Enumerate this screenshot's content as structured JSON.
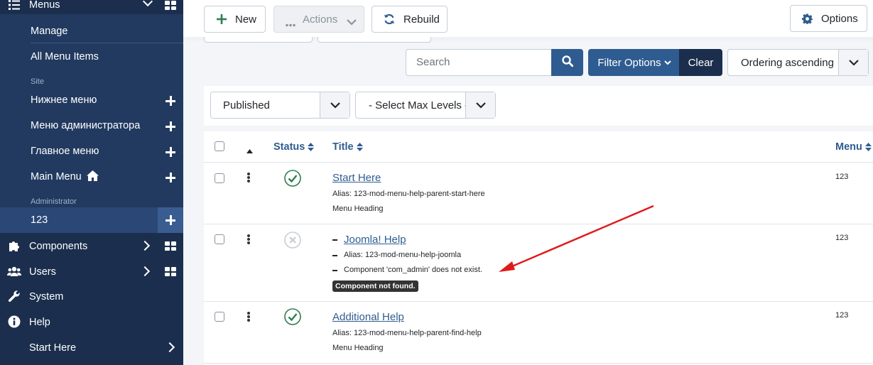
{
  "sidebar": {
    "menus_label": "Menus",
    "manage": "Manage",
    "all_menu_items": "All Menu Items",
    "site_section": "Site",
    "site_menus": [
      "Нижнее меню",
      "Меню администратора",
      "Главное меню",
      "Main Menu"
    ],
    "admin_section": "Administrator",
    "admin_menu": "123",
    "components": "Components",
    "users": "Users",
    "system": "System",
    "help": "Help",
    "start_here": "Start Here"
  },
  "toolbar": {
    "new_label": "New",
    "actions_label": "Actions",
    "rebuild_label": "Rebuild",
    "options_label": "Options"
  },
  "search": {
    "placeholder": "Search",
    "filter_options_label": "Filter Options",
    "clear_label": "Clear",
    "ordering_value": "Ordering ascending"
  },
  "filters": {
    "published_value": "Published",
    "max_levels_value": "- Select Max Levels -"
  },
  "table": {
    "headers": {
      "status": "Status",
      "title": "Title",
      "menu": "Menu"
    },
    "rows": [
      {
        "title": "Start Here",
        "alias": "Alias: 123-mod-menu-help-parent-start-here",
        "type": "Menu Heading",
        "menu": "123",
        "status": "published"
      },
      {
        "title": "Joomla! Help",
        "alias": "Alias: 123-mod-menu-help-joomla",
        "type": "Component 'com_admin' does not exist.",
        "badge": "Component not found.",
        "menu": "123",
        "status": "unpublished"
      },
      {
        "title": "Additional Help",
        "alias": "Alias: 123-mod-menu-help-parent-find-help",
        "type": "Menu Heading",
        "menu": "123",
        "status": "published"
      }
    ]
  },
  "colors": {
    "sidebar_bg": "#1b2e4d",
    "primary": "#2f5c90",
    "success": "#2e7d4f",
    "annotation_arrow": "#e01b1b"
  }
}
